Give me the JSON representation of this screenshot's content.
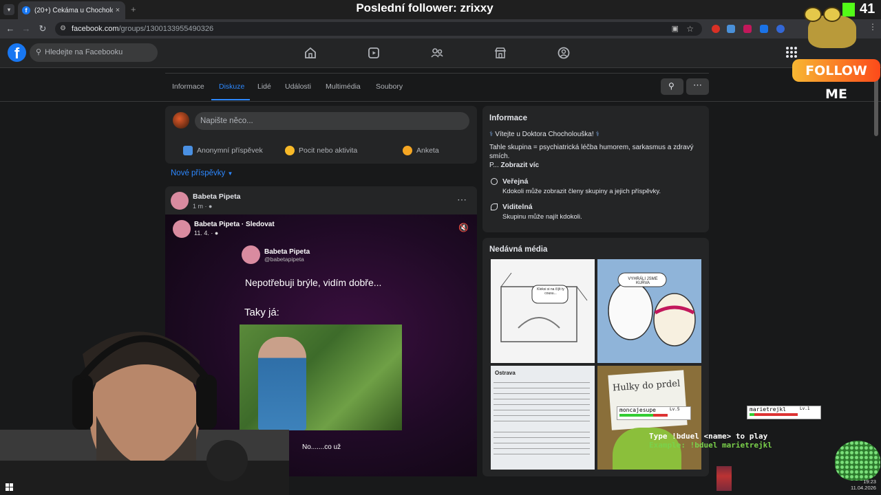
{
  "browser": {
    "tab_title": "(20+) Čekáma u Chocholouška",
    "tab_close": "×",
    "new_tab": "+",
    "url_host": "facebook.com",
    "url_path": "/groups/1300133955490326"
  },
  "fb": {
    "logo": "f",
    "search_placeholder": "Hledejte na Facebooku",
    "nav_icons": [
      "home-icon",
      "video-icon",
      "groups-icon",
      "marketplace-icon",
      "gaming-icon"
    ]
  },
  "group_nav": {
    "tabs": [
      "Informace",
      "Diskuze",
      "Lidé",
      "Události",
      "Multimédia",
      "Soubory"
    ],
    "active": "Diskuze"
  },
  "composer": {
    "placeholder": "Napište něco...",
    "buttons": [
      "Anonymní příspěvek",
      "Pocit nebo aktivita",
      "Anketa"
    ]
  },
  "feed": {
    "sort_label": "Nové příspěvky",
    "post": {
      "author": "Babeta Pipeta",
      "time": "1 m ·",
      "video": {
        "header_author": "Babeta Pipeta · Sledovat",
        "header_date": "11. 4. ·",
        "quote_name": "Babeta Pipeta",
        "quote_handle": "@babetapipeta",
        "text1": "Nepotřebuji brýle, vidím dobře...",
        "text2": "Taky já:",
        "caption": "No.......co už"
      }
    }
  },
  "info": {
    "title": "Informace",
    "welcome": "Vítejte u Doktora Chocholouška!",
    "description": "Tahle skupina = psychiatrická léčba humorem, sarkasmus a zdravý smích.",
    "short": "P...",
    "show_more": "Zobrazit víc",
    "public_title": "Veřejná",
    "public_desc": "Kdokoli může zobrazit členy skupiny a jejich příspěvky.",
    "visible_title": "Viditelná",
    "visible_desc": "Skupinu může najít kdokoli."
  },
  "media": {
    "title": "Nedávná média",
    "thumb_texts": [
      "Kleksi si na číjít ty cousu...",
      "VYHRÁLI JSME KURVA",
      "Ostrava",
      "Hulky do prdel"
    ]
  },
  "overlay": {
    "title": "Poslední follower: zrixxy",
    "kick_count": "41",
    "follow_me": "FOLLOW ME",
    "duel_players": [
      {
        "name": "moncajesupe",
        "level": "Lv.5",
        "hp": 0.7
      },
      {
        "name": "marietrejkl",
        "level": "Lv.1",
        "hp": 0.1
      }
    ],
    "duel_line1": "Type !bduel <name> to play",
    "duel_line2": "Example: !bduel marietrejkl",
    "clock_time": "19:23",
    "clock_date": "11.04.2026"
  },
  "colors": {
    "fb_blue": "#1877f2",
    "active_tab": "#2d88ff",
    "bg": "#18191a",
    "card": "#242526"
  }
}
